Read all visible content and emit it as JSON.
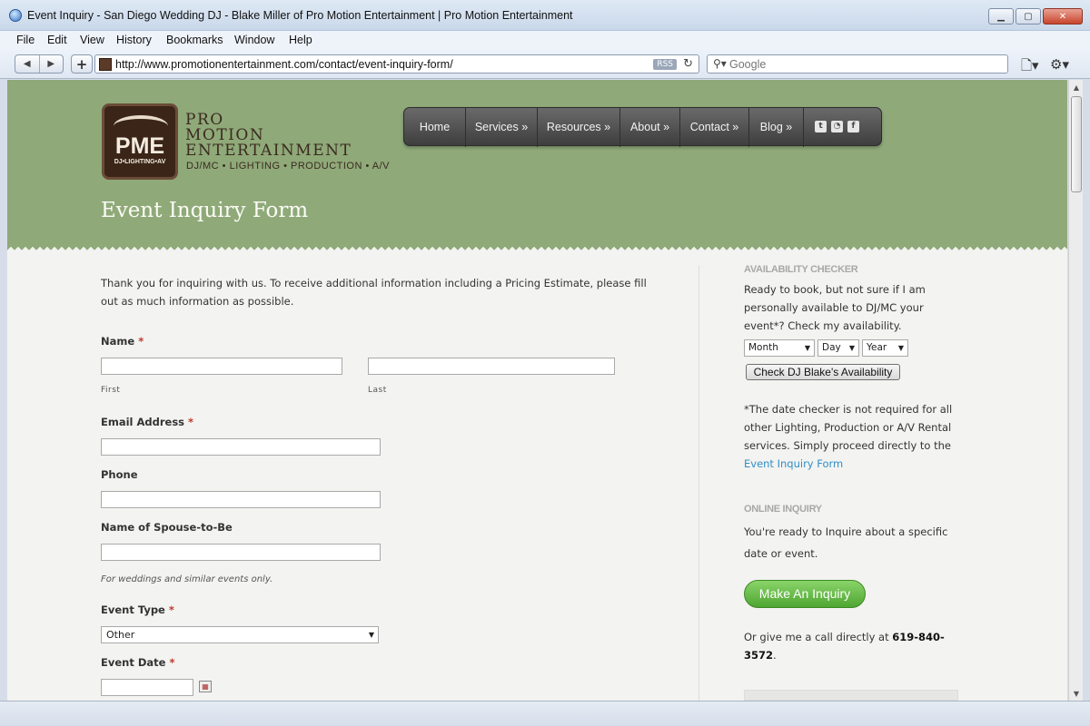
{
  "window": {
    "title": "Event Inquiry - San Diego Wedding DJ - Blake Miller of Pro Motion Entertainment | Pro Motion Entertainment",
    "buttons": {
      "minimize": "▁",
      "maximize": "▢",
      "close": "✕"
    }
  },
  "menu": [
    "File",
    "Edit",
    "View",
    "History",
    "Bookmarks",
    "Window",
    "Help"
  ],
  "toolbar": {
    "url": "http://www.promotionentertainment.com/contact/event-inquiry-form/",
    "rss": "RSS",
    "search_placeholder": "Google"
  },
  "logo": {
    "badge": "PME",
    "badge_sub": "DJ•LIGHTING•AV",
    "line1": "PRO",
    "line2": "MOTION",
    "line3": "ENTERTAINMENT",
    "tagline": "DJ/MC • LIGHTING • PRODUCTION • A/V"
  },
  "nav": [
    "Home",
    "Services »",
    "Resources »",
    "About »",
    "Contact »",
    "Blog »"
  ],
  "social": [
    "twitter-icon",
    "rss-icon",
    "facebook-icon"
  ],
  "page_title": "Event Inquiry Form",
  "intro": "Thank you for inquiring with us. To receive additional information including a Pricing Estimate, please fill out as much information as possible.",
  "form": {
    "name_label": "Name",
    "required_mark": "*",
    "first_label": "First",
    "last_label": "Last",
    "email_label": "Email Address",
    "phone_label": "Phone",
    "spouse_label": "Name of Spouse-to-Be",
    "spouse_hint": "For weddings and similar events only.",
    "event_type_label": "Event Type",
    "event_type_value": "Other",
    "event_date_label": "Event Date"
  },
  "sidebar": {
    "avail_heading": "AVAILABILITY CHECKER",
    "avail_text": "Ready to book, but not sure if I am personally available to DJ/MC your event*? Check my availability.",
    "month": "Month",
    "day": "Day",
    "year": "Year",
    "check_button": "Check DJ Blake's Availability",
    "note_text": "*The date checker is not required for all other Lighting, Production or A/V Rental services. Simply proceed directly to the",
    "note_link": "Event Inquiry Form",
    "online_heading": "ONLINE INQUIRY",
    "online_text": "You're ready to Inquire about a specific date or event.",
    "inquiry_button": "Make An Inquiry",
    "call_text": "Or give me a call directly at",
    "phone": "619-840-3572",
    "period": "."
  }
}
